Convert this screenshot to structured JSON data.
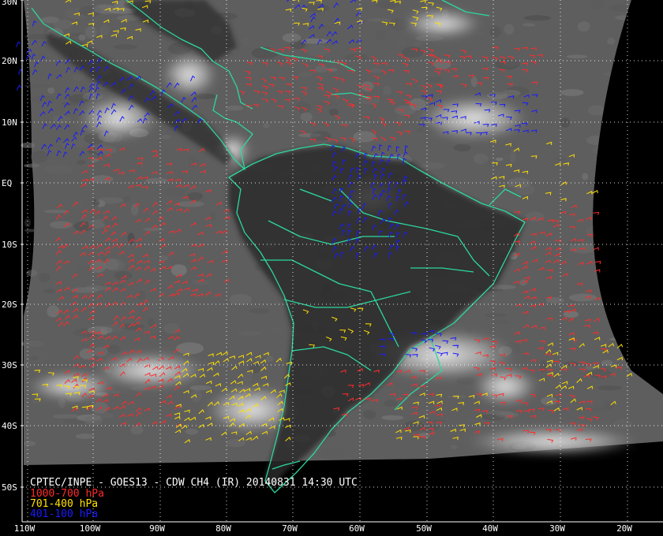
{
  "map": {
    "title": "CPTEC/INPE - GOES13 - CDW CH4 (IR) 20140831 14:30 UTC",
    "legend": [
      {
        "label": "1000-700 hPa",
        "color": "#ff2b2b"
      },
      {
        "label": "701-400 hPa",
        "color": "#ffe000"
      },
      {
        "label": "401-100 hPa",
        "color": "#1a1aff"
      }
    ],
    "lat_labels": [
      "30N",
      "20N",
      "10N",
      "EQ",
      "10S",
      "20S",
      "30S",
      "40S",
      "50S"
    ],
    "lon_labels": [
      "110W",
      "100W",
      "90W",
      "80W",
      "70W",
      "60W",
      "50W",
      "40W",
      "30W",
      "20W"
    ],
    "colors": {
      "background": "#000000",
      "coastline": "#2bd8a0",
      "grid": "#ffffff"
    }
  }
}
